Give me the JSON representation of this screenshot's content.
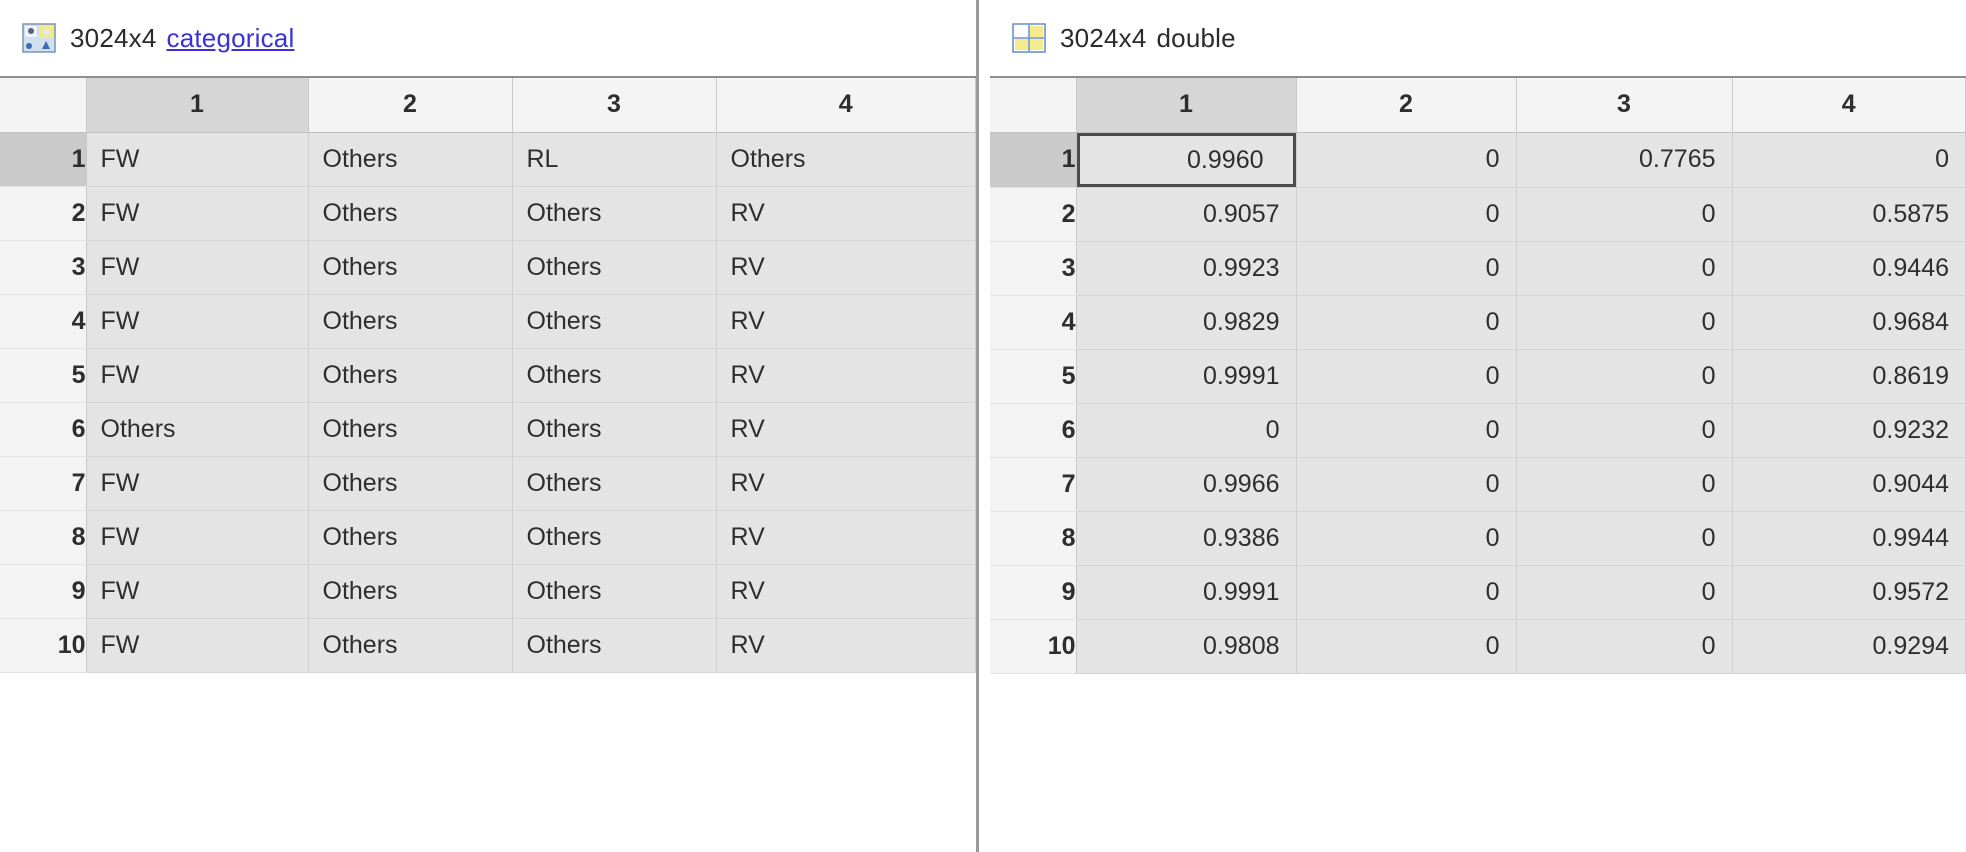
{
  "left_panel": {
    "icon": "categorical-variable-icon",
    "size_label": "3024x4",
    "type_label": "categorical",
    "type_is_link": true,
    "columns": [
      "1",
      "2",
      "3",
      "4"
    ],
    "selected_column": "1",
    "selected_row": "1",
    "rows": [
      {
        "index": "1",
        "values": [
          "FW",
          "Others",
          "RL",
          "Others"
        ]
      },
      {
        "index": "2",
        "values": [
          "FW",
          "Others",
          "Others",
          "RV"
        ]
      },
      {
        "index": "3",
        "values": [
          "FW",
          "Others",
          "Others",
          "RV"
        ]
      },
      {
        "index": "4",
        "values": [
          "FW",
          "Others",
          "Others",
          "RV"
        ]
      },
      {
        "index": "5",
        "values": [
          "FW",
          "Others",
          "Others",
          "RV"
        ]
      },
      {
        "index": "6",
        "values": [
          "Others",
          "Others",
          "Others",
          "RV"
        ]
      },
      {
        "index": "7",
        "values": [
          "FW",
          "Others",
          "Others",
          "RV"
        ]
      },
      {
        "index": "8",
        "values": [
          "FW",
          "Others",
          "Others",
          "RV"
        ]
      },
      {
        "index": "9",
        "values": [
          "FW",
          "Others",
          "Others",
          "RV"
        ]
      },
      {
        "index": "10",
        "values": [
          "FW",
          "Others",
          "Others",
          "RV"
        ]
      }
    ]
  },
  "right_panel": {
    "icon": "double-matrix-icon",
    "size_label": "3024x4",
    "type_label": "double",
    "type_is_link": false,
    "columns": [
      "1",
      "2",
      "3",
      "4"
    ],
    "selected_column": "1",
    "selected_row": "1",
    "selected_cell": {
      "row": "1",
      "column": "1",
      "value": "0.9960"
    },
    "rows": [
      {
        "index": "1",
        "values": [
          "0.9960",
          "0",
          "0.7765",
          "0"
        ]
      },
      {
        "index": "2",
        "values": [
          "0.9057",
          "0",
          "0",
          "0.5875"
        ]
      },
      {
        "index": "3",
        "values": [
          "0.9923",
          "0",
          "0",
          "0.9446"
        ]
      },
      {
        "index": "4",
        "values": [
          "0.9829",
          "0",
          "0",
          "0.9684"
        ]
      },
      {
        "index": "5",
        "values": [
          "0.9991",
          "0",
          "0",
          "0.8619"
        ]
      },
      {
        "index": "6",
        "values": [
          "0",
          "0",
          "0",
          "0.9232"
        ]
      },
      {
        "index": "7",
        "values": [
          "0.9966",
          "0",
          "0",
          "0.9044"
        ]
      },
      {
        "index": "8",
        "values": [
          "0.9386",
          "0",
          "0",
          "0.9944"
        ]
      },
      {
        "index": "9",
        "values": [
          "0.9991",
          "0",
          "0",
          "0.9572"
        ]
      },
      {
        "index": "10",
        "values": [
          "0.9808",
          "0",
          "0",
          "0.9294"
        ]
      }
    ]
  },
  "colors": {
    "link": "#3a32d8",
    "cell_background": "#e4e4e4",
    "header_background": "#f3f3f3",
    "selection_border": "#4c4c4c",
    "selected_header": "#cacaca"
  }
}
